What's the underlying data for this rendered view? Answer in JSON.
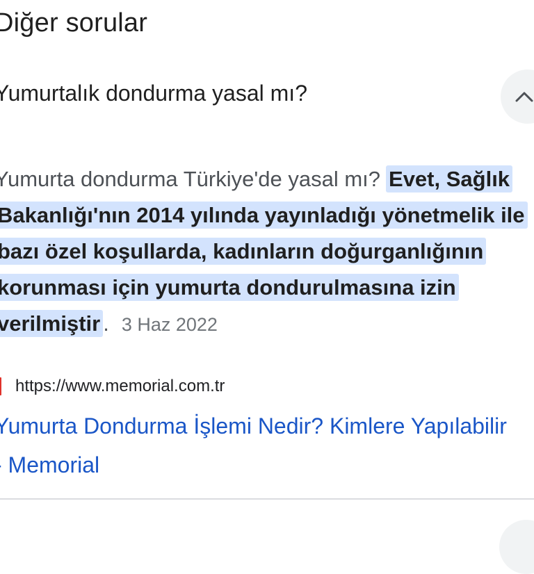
{
  "section": {
    "title": "Diğer sorular"
  },
  "question": {
    "text": "Yumurtalık dondurma yasal mı?",
    "toggle_icon": "chevron-up-icon"
  },
  "answer": {
    "lead": "Yumurta dondurma Türkiye'de yasal mı?",
    "highlight_lines": [
      "Evet, Sağlık",
      "Bakanlığı'nın 2014 yılında yayınladığı yönetmelik ile",
      "bazı özel koşullarda, kadınların doğurganlığının",
      "korunması için yumurta dondurulmasına izin",
      "verilmiştir"
    ],
    "trailing": ".",
    "date": "3 Haz 2022"
  },
  "source": {
    "url": "https://www.memorial.com.tr",
    "favicon_color": "#e0322b"
  },
  "result": {
    "title_lines": [
      "Yumurta Dondurma İşlemi Nedir? Kimlere Yapılabilir",
      "- Memorial"
    ]
  },
  "colors": {
    "highlight": "#d3e3fd",
    "link": "#1a56c7"
  }
}
